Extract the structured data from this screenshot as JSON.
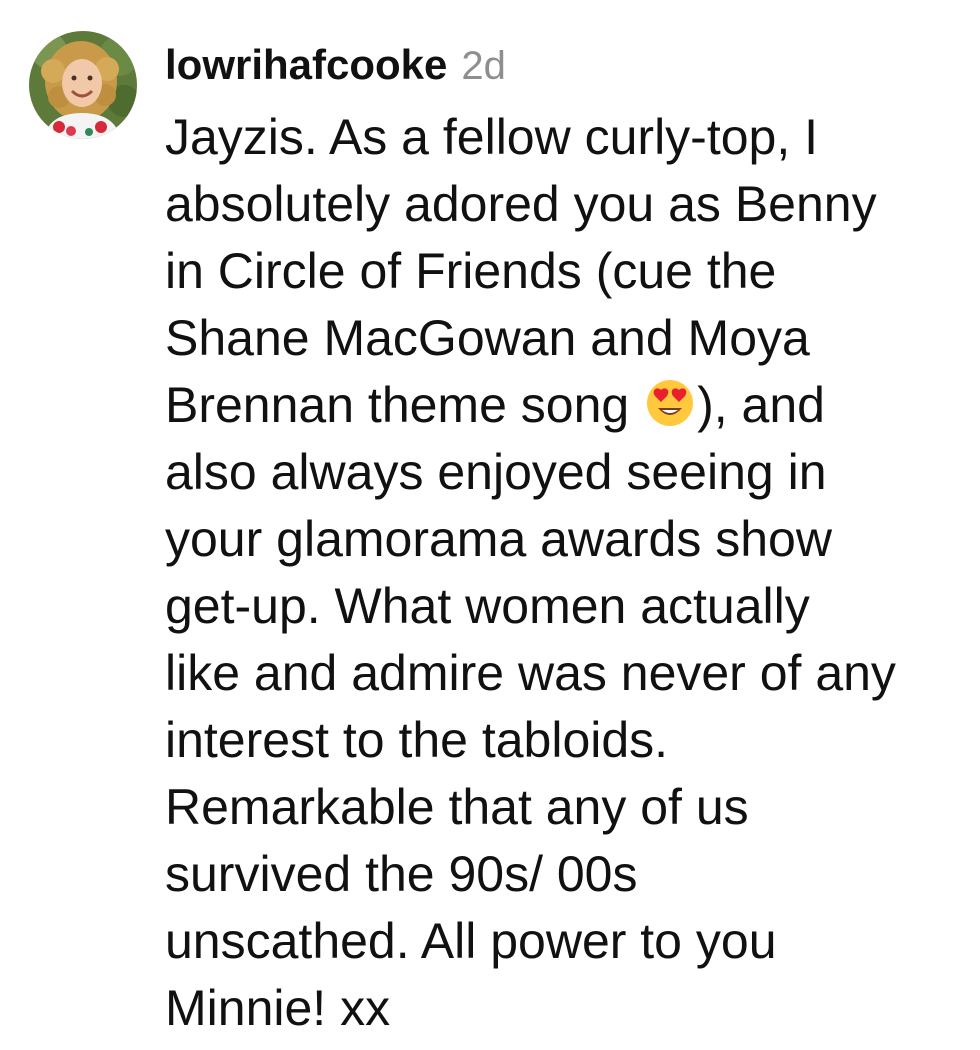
{
  "comment": {
    "username": "lowrihafcooke",
    "timestamp": "2d",
    "text_lines": [
      "Jayzis. As a fellow curly-top, I",
      "absolutely adored you as Benny",
      "in Circle of Friends (cue the",
      "Shane MacGowan and Moya",
      "Brennan theme song",
      "), and",
      "also always enjoyed seeing in",
      "your glamorama awards show",
      "get-up. What women actually",
      "like and admire was never of any",
      "interest to the tabloids.",
      "Remarkable that any of us",
      "survived the 90s/ 00s",
      "unscathed. All power to you",
      "Minnie! xx"
    ],
    "emoji": "heart-eyes-emoji",
    "avatar": "profile-photo"
  },
  "colors": {
    "text": "#111111",
    "timestamp": "#8e8e8e",
    "background": "#ffffff",
    "emoji_face": "#ffc83d",
    "emoji_hearts": "#e8202e"
  }
}
